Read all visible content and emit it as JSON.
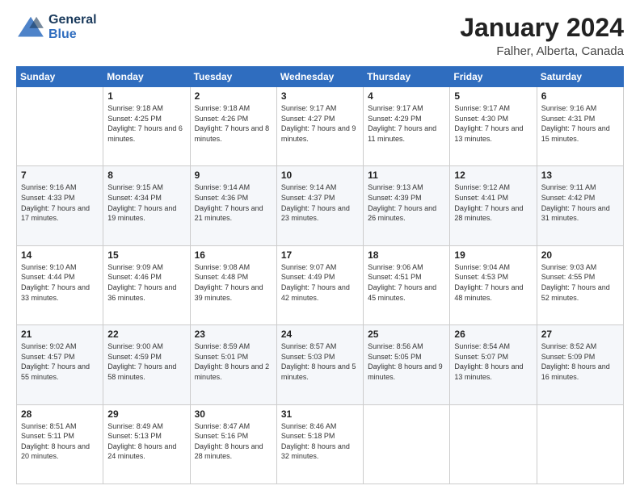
{
  "header": {
    "logo_line1": "General",
    "logo_line2": "Blue",
    "title": "January 2024",
    "subtitle": "Falher, Alberta, Canada"
  },
  "weekdays": [
    "Sunday",
    "Monday",
    "Tuesday",
    "Wednesday",
    "Thursday",
    "Friday",
    "Saturday"
  ],
  "weeks": [
    [
      {
        "day": "",
        "sunrise": "",
        "sunset": "",
        "daylight": ""
      },
      {
        "day": "1",
        "sunrise": "Sunrise: 9:18 AM",
        "sunset": "Sunset: 4:25 PM",
        "daylight": "Daylight: 7 hours and 6 minutes."
      },
      {
        "day": "2",
        "sunrise": "Sunrise: 9:18 AM",
        "sunset": "Sunset: 4:26 PM",
        "daylight": "Daylight: 7 hours and 8 minutes."
      },
      {
        "day": "3",
        "sunrise": "Sunrise: 9:17 AM",
        "sunset": "Sunset: 4:27 PM",
        "daylight": "Daylight: 7 hours and 9 minutes."
      },
      {
        "day": "4",
        "sunrise": "Sunrise: 9:17 AM",
        "sunset": "Sunset: 4:29 PM",
        "daylight": "Daylight: 7 hours and 11 minutes."
      },
      {
        "day": "5",
        "sunrise": "Sunrise: 9:17 AM",
        "sunset": "Sunset: 4:30 PM",
        "daylight": "Daylight: 7 hours and 13 minutes."
      },
      {
        "day": "6",
        "sunrise": "Sunrise: 9:16 AM",
        "sunset": "Sunset: 4:31 PM",
        "daylight": "Daylight: 7 hours and 15 minutes."
      }
    ],
    [
      {
        "day": "7",
        "sunrise": "Sunrise: 9:16 AM",
        "sunset": "Sunset: 4:33 PM",
        "daylight": "Daylight: 7 hours and 17 minutes."
      },
      {
        "day": "8",
        "sunrise": "Sunrise: 9:15 AM",
        "sunset": "Sunset: 4:34 PM",
        "daylight": "Daylight: 7 hours and 19 minutes."
      },
      {
        "day": "9",
        "sunrise": "Sunrise: 9:14 AM",
        "sunset": "Sunset: 4:36 PM",
        "daylight": "Daylight: 7 hours and 21 minutes."
      },
      {
        "day": "10",
        "sunrise": "Sunrise: 9:14 AM",
        "sunset": "Sunset: 4:37 PM",
        "daylight": "Daylight: 7 hours and 23 minutes."
      },
      {
        "day": "11",
        "sunrise": "Sunrise: 9:13 AM",
        "sunset": "Sunset: 4:39 PM",
        "daylight": "Daylight: 7 hours and 26 minutes."
      },
      {
        "day": "12",
        "sunrise": "Sunrise: 9:12 AM",
        "sunset": "Sunset: 4:41 PM",
        "daylight": "Daylight: 7 hours and 28 minutes."
      },
      {
        "day": "13",
        "sunrise": "Sunrise: 9:11 AM",
        "sunset": "Sunset: 4:42 PM",
        "daylight": "Daylight: 7 hours and 31 minutes."
      }
    ],
    [
      {
        "day": "14",
        "sunrise": "Sunrise: 9:10 AM",
        "sunset": "Sunset: 4:44 PM",
        "daylight": "Daylight: 7 hours and 33 minutes."
      },
      {
        "day": "15",
        "sunrise": "Sunrise: 9:09 AM",
        "sunset": "Sunset: 4:46 PM",
        "daylight": "Daylight: 7 hours and 36 minutes."
      },
      {
        "day": "16",
        "sunrise": "Sunrise: 9:08 AM",
        "sunset": "Sunset: 4:48 PM",
        "daylight": "Daylight: 7 hours and 39 minutes."
      },
      {
        "day": "17",
        "sunrise": "Sunrise: 9:07 AM",
        "sunset": "Sunset: 4:49 PM",
        "daylight": "Daylight: 7 hours and 42 minutes."
      },
      {
        "day": "18",
        "sunrise": "Sunrise: 9:06 AM",
        "sunset": "Sunset: 4:51 PM",
        "daylight": "Daylight: 7 hours and 45 minutes."
      },
      {
        "day": "19",
        "sunrise": "Sunrise: 9:04 AM",
        "sunset": "Sunset: 4:53 PM",
        "daylight": "Daylight: 7 hours and 48 minutes."
      },
      {
        "day": "20",
        "sunrise": "Sunrise: 9:03 AM",
        "sunset": "Sunset: 4:55 PM",
        "daylight": "Daylight: 7 hours and 52 minutes."
      }
    ],
    [
      {
        "day": "21",
        "sunrise": "Sunrise: 9:02 AM",
        "sunset": "Sunset: 4:57 PM",
        "daylight": "Daylight: 7 hours and 55 minutes."
      },
      {
        "day": "22",
        "sunrise": "Sunrise: 9:00 AM",
        "sunset": "Sunset: 4:59 PM",
        "daylight": "Daylight: 7 hours and 58 minutes."
      },
      {
        "day": "23",
        "sunrise": "Sunrise: 8:59 AM",
        "sunset": "Sunset: 5:01 PM",
        "daylight": "Daylight: 8 hours and 2 minutes."
      },
      {
        "day": "24",
        "sunrise": "Sunrise: 8:57 AM",
        "sunset": "Sunset: 5:03 PM",
        "daylight": "Daylight: 8 hours and 5 minutes."
      },
      {
        "day": "25",
        "sunrise": "Sunrise: 8:56 AM",
        "sunset": "Sunset: 5:05 PM",
        "daylight": "Daylight: 8 hours and 9 minutes."
      },
      {
        "day": "26",
        "sunrise": "Sunrise: 8:54 AM",
        "sunset": "Sunset: 5:07 PM",
        "daylight": "Daylight: 8 hours and 13 minutes."
      },
      {
        "day": "27",
        "sunrise": "Sunrise: 8:52 AM",
        "sunset": "Sunset: 5:09 PM",
        "daylight": "Daylight: 8 hours and 16 minutes."
      }
    ],
    [
      {
        "day": "28",
        "sunrise": "Sunrise: 8:51 AM",
        "sunset": "Sunset: 5:11 PM",
        "daylight": "Daylight: 8 hours and 20 minutes."
      },
      {
        "day": "29",
        "sunrise": "Sunrise: 8:49 AM",
        "sunset": "Sunset: 5:13 PM",
        "daylight": "Daylight: 8 hours and 24 minutes."
      },
      {
        "day": "30",
        "sunrise": "Sunrise: 8:47 AM",
        "sunset": "Sunset: 5:16 PM",
        "daylight": "Daylight: 8 hours and 28 minutes."
      },
      {
        "day": "31",
        "sunrise": "Sunrise: 8:46 AM",
        "sunset": "Sunset: 5:18 PM",
        "daylight": "Daylight: 8 hours and 32 minutes."
      },
      {
        "day": "",
        "sunrise": "",
        "sunset": "",
        "daylight": ""
      },
      {
        "day": "",
        "sunrise": "",
        "sunset": "",
        "daylight": ""
      },
      {
        "day": "",
        "sunrise": "",
        "sunset": "",
        "daylight": ""
      }
    ]
  ]
}
